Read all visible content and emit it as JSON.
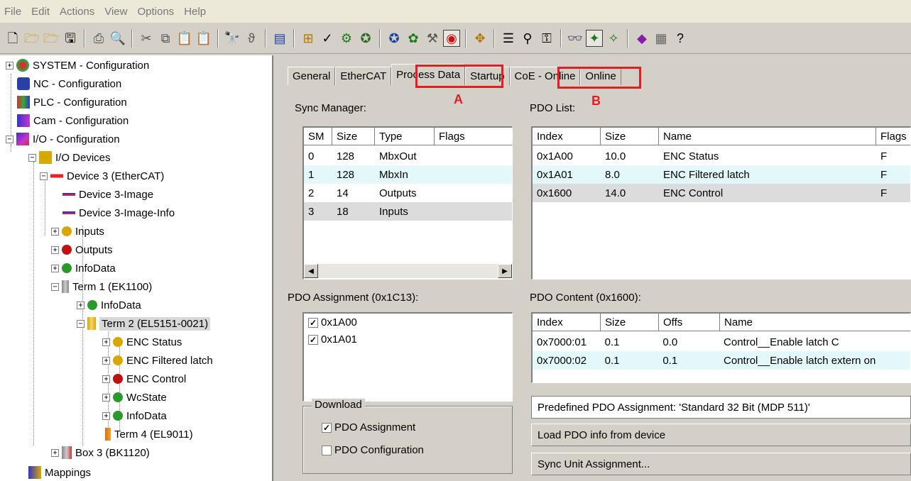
{
  "menu": [
    "File",
    "Edit",
    "Actions",
    "View",
    "Options",
    "Help"
  ],
  "toolbar_icons": [
    "new-file",
    "open-folder",
    "open-project",
    "save",
    "print",
    "print-preview",
    "cut",
    "copy",
    "paste",
    "paste-special",
    "find",
    "find-next",
    "monitor",
    "network-config",
    "check",
    "activate-config",
    "wizard",
    "scan",
    "devices",
    "tools",
    "record",
    "target-select",
    "list",
    "zoom",
    "find-devices",
    "glasses",
    "green-device",
    "tune",
    "book",
    "calculator",
    "help"
  ],
  "tree": {
    "items": [
      {
        "label": "SYSTEM - Configuration"
      },
      {
        "label": "NC - Configuration"
      },
      {
        "label": "PLC - Configuration"
      },
      {
        "label": "Cam - Configuration"
      },
      {
        "label": "I/O - Configuration"
      },
      {
        "label": "I/O Devices"
      },
      {
        "label": "Device 3 (EtherCAT)"
      },
      {
        "label": "Device 3-Image"
      },
      {
        "label": "Device 3-Image-Info"
      },
      {
        "label": "Inputs"
      },
      {
        "label": "Outputs"
      },
      {
        "label": "InfoData"
      },
      {
        "label": "Term 1 (EK1100)"
      },
      {
        "label": "InfoData"
      },
      {
        "label": "Term 2 (EL5151-0021)"
      },
      {
        "label": "ENC Status"
      },
      {
        "label": "ENC Filtered latch"
      },
      {
        "label": "ENC Control"
      },
      {
        "label": "WcState"
      },
      {
        "label": "InfoData"
      },
      {
        "label": "Term 4 (EL9011)"
      },
      {
        "label": "Box 3 (BK1120)"
      },
      {
        "label": "Mappings"
      }
    ]
  },
  "tabs": [
    "General",
    "EtherCAT",
    "Process Data",
    "Startup",
    "CoE - Online",
    "Online"
  ],
  "markers": {
    "a": "A",
    "b": "B"
  },
  "sync_manager": {
    "label": "Sync Manager:",
    "columns": [
      "SM",
      "Size",
      "Type",
      "Flags"
    ],
    "rows": [
      {
        "sm": "0",
        "size": "128",
        "type": "MbxOut",
        "flags": ""
      },
      {
        "sm": "1",
        "size": "128",
        "type": "MbxIn",
        "flags": ""
      },
      {
        "sm": "2",
        "size": "14",
        "type": "Outputs",
        "flags": ""
      },
      {
        "sm": "3",
        "size": "18",
        "type": "Inputs",
        "flags": ""
      }
    ]
  },
  "pdo_list": {
    "label": "PDO List:",
    "columns": [
      "Index",
      "Size",
      "Name",
      "Flags"
    ],
    "rows": [
      {
        "index": "0x1A00",
        "size": "10.0",
        "name": "ENC Status",
        "flags": "F"
      },
      {
        "index": "0x1A01",
        "size": "8.0",
        "name": "ENC Filtered latch",
        "flags": "F"
      },
      {
        "index": "0x1600",
        "size": "14.0",
        "name": "ENC Control",
        "flags": "F"
      }
    ]
  },
  "pdo_assignment": {
    "label": "PDO Assignment (0x1C13):",
    "items": [
      {
        "label": "0x1A00",
        "checked": true
      },
      {
        "label": "0x1A01",
        "checked": true
      }
    ]
  },
  "pdo_content": {
    "label": "PDO Content (0x1600):",
    "columns": [
      "Index",
      "Size",
      "Offs",
      "Name"
    ],
    "rows": [
      {
        "index": "0x7000:01",
        "size": "0.1",
        "offs": "0.0",
        "name": "Control__Enable latch C"
      },
      {
        "index": "0x7000:02",
        "size": "0.1",
        "offs": "0.1",
        "name": "Control__Enable latch extern on"
      }
    ]
  },
  "download": {
    "label": "Download",
    "options": [
      {
        "label": "PDO Assignment",
        "checked": true
      },
      {
        "label": "PDO Configuration",
        "checked": false
      }
    ]
  },
  "predefined": "Predefined PDO Assignment: 'Standard 32 Bit (MDP 511)'",
  "load_pdo": "Load PDO info from device",
  "sync_unit": "Sync Unit Assignment...",
  "colors": {
    "highlight_red": "#e41e1e",
    "alt_row": "#e3f8fb",
    "selected_row": "#dcdcdc"
  }
}
